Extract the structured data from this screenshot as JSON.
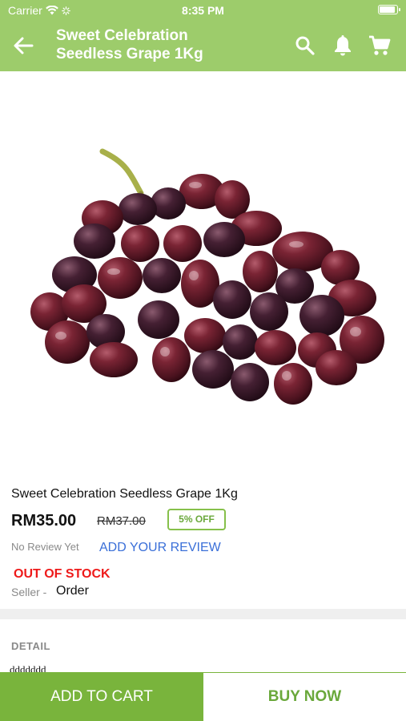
{
  "status_bar": {
    "carrier": "Carrier",
    "time": "8:35 PM"
  },
  "app_bar": {
    "title": "Sweet Celebration Seedless Grape 1Kg",
    "icons": [
      "back-arrow-icon",
      "search-icon",
      "bell-icon",
      "cart-icon"
    ]
  },
  "product": {
    "name": "Sweet Celebration Seedless Grape 1Kg",
    "price": "RM35.00",
    "original_price": "RM37.00",
    "discount": "5% OFF",
    "review_status": "No Review Yet",
    "review_link": "ADD YOUR REVIEW",
    "stock_status": "OUT OF STOCK",
    "seller_label": "Seller -",
    "seller_value": "Order"
  },
  "detail": {
    "title": "DETAIL",
    "text": "ddddddd"
  },
  "actions": {
    "add_to_cart": "ADD TO CART",
    "buy_now": "BUY NOW"
  },
  "colors": {
    "header_green": "#9dcc6b",
    "button_green": "#79b43c",
    "discount_green": "#6aa83b",
    "link_blue": "#3a6fd8",
    "stock_red": "#ee1a1a"
  }
}
